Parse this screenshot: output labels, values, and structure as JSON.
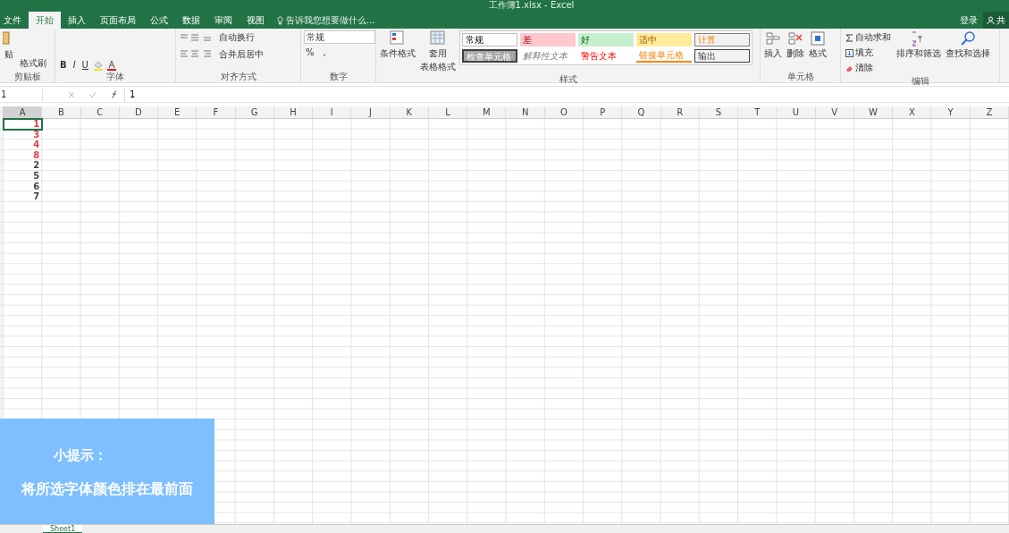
{
  "window": {
    "title": "工作簿1.xlsx - Excel"
  },
  "account": {
    "sign_in": "登录",
    "share": "共"
  },
  "tabs": [
    {
      "label": "文件",
      "selected": false
    },
    {
      "label": "开始",
      "selected": true
    },
    {
      "label": "插入",
      "selected": false
    },
    {
      "label": "页面布局",
      "selected": false
    },
    {
      "label": "公式",
      "selected": false
    },
    {
      "label": "数据",
      "selected": false
    },
    {
      "label": "审阅",
      "selected": false
    },
    {
      "label": "视图",
      "selected": false
    }
  ],
  "tell_me": {
    "placeholder": "告诉我您想要做什么..."
  },
  "ribbon": {
    "clipboard": {
      "label": "剪贴板",
      "paste": "贴",
      "format_painter": "格式刷"
    },
    "font": {
      "label": "字体",
      "bold": "B",
      "italic": "I",
      "underline": "U"
    },
    "alignment": {
      "label": "对齐方式",
      "wrap": "自动换行",
      "merge": "合并后居中"
    },
    "number": {
      "label": "数字",
      "format": "常规",
      "percent": "%",
      "comma": ","
    },
    "styles": {
      "label": "样式",
      "conditional": "条件格式",
      "table_format": [
        "套用",
        "表格格式"
      ],
      "cells": [
        {
          "label": "常规",
          "kind": "normal"
        },
        {
          "label": "差",
          "kind": "bad"
        },
        {
          "label": "好",
          "kind": "good"
        },
        {
          "label": "适中",
          "kind": "neutral"
        },
        {
          "label": "计算",
          "kind": "calc"
        },
        {
          "label": "检查单元格",
          "kind": "check"
        },
        {
          "label": "解释性文本",
          "kind": "explain"
        },
        {
          "label": "警告文本",
          "kind": "warn"
        },
        {
          "label": "链接单元格",
          "kind": "link"
        },
        {
          "label": "输出",
          "kind": "output"
        }
      ]
    },
    "cells": {
      "label": "单元格",
      "insert": "插入",
      "delete": "删除",
      "format": "格式"
    },
    "editing": {
      "label": "编辑",
      "autosum": "自动求和",
      "fill": "填充",
      "clear": "清除",
      "sort": "排序和筛选",
      "find": "查找和选择"
    }
  },
  "formula_bar": {
    "name_box": "1",
    "value": "1"
  },
  "columns": [
    "A",
    "B",
    "C",
    "D",
    "E",
    "F",
    "G",
    "H",
    "I",
    "J",
    "K",
    "L",
    "M",
    "N",
    "O",
    "P",
    "Q",
    "R",
    "S",
    "T",
    "U",
    "V",
    "W",
    "X",
    "Y",
    "Z"
  ],
  "cells_a": [
    {
      "value": "1",
      "color": "#e0404a",
      "selected": true
    },
    {
      "value": "3",
      "color": "#e0404a",
      "selected": false
    },
    {
      "value": "4",
      "color": "#e0404a",
      "selected": false
    },
    {
      "value": "8",
      "color": "#e0404a",
      "selected": false
    },
    {
      "value": "2",
      "color": "#444444",
      "selected": false
    },
    {
      "value": "5",
      "color": "#444444",
      "selected": false
    },
    {
      "value": "6",
      "color": "#444444",
      "selected": false
    },
    {
      "value": "7",
      "color": "#444444",
      "selected": false
    }
  ],
  "sheet_tabs": [
    {
      "label": "Sheet1",
      "selected": true
    }
  ],
  "tip": {
    "title": "小提示：",
    "text": "将所选字体颜色排在最前面"
  }
}
